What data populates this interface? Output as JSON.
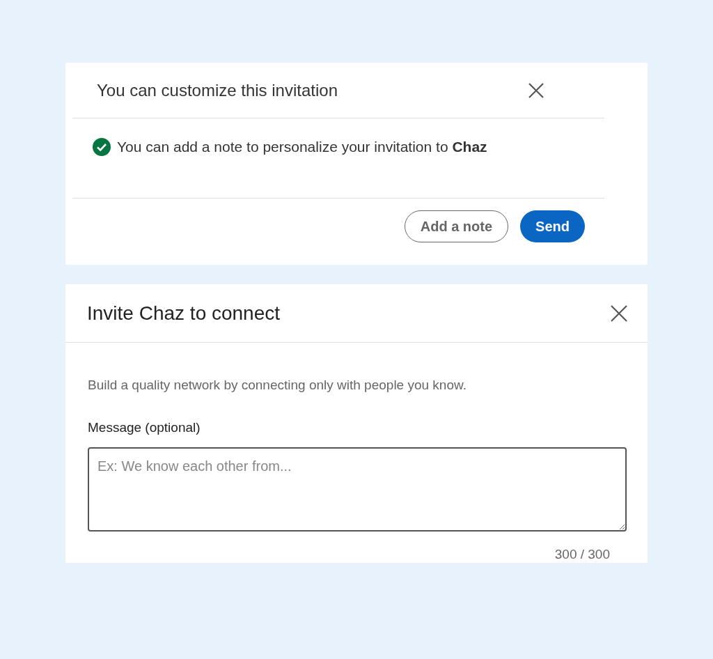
{
  "invitation_dialog": {
    "title": "You can customize this invitation",
    "message": "You can add a note to personalize your invitation to **Chaz**",
    "buttons": [
      {
        "label": "Add a note",
        "kind": "secondary"
      },
      {
        "label": "Send",
        "kind": "primary"
      }
    ]
  },
  "connect_dialog": {
    "title": "Invite Chaz to connect",
    "description": "Build a quality network by connecting only with people you know.",
    "field_label": "Message (optional)",
    "placeholder": "Ex: We know each other from...",
    "counter": "300 / 300"
  }
}
